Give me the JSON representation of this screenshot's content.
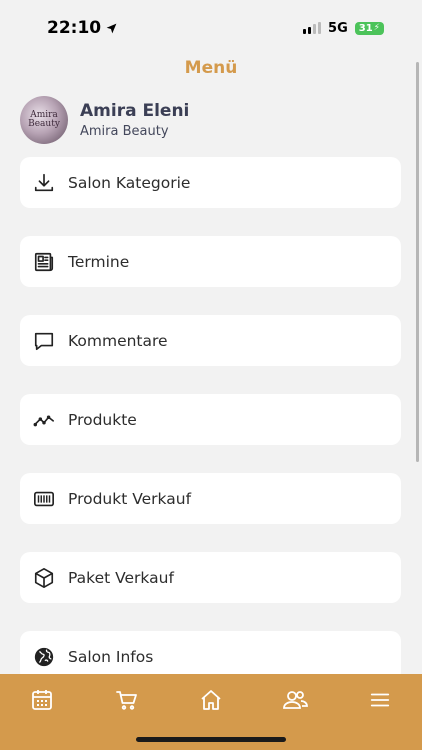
{
  "status": {
    "time": "22:10",
    "network": "5G",
    "battery": "31"
  },
  "header": {
    "title": "Menü"
  },
  "profile": {
    "name": "Amira Eleni",
    "subtitle": "Amira Beauty",
    "avatar_text": "Amira Beauty"
  },
  "menu": {
    "items": [
      {
        "label": "Salon Kategorie",
        "icon": "download-icon"
      },
      {
        "label": "Termine",
        "icon": "newspaper-icon"
      },
      {
        "label": "Kommentare",
        "icon": "chat-icon"
      },
      {
        "label": "Produkte",
        "icon": "trend-icon"
      },
      {
        "label": "Produkt Verkauf",
        "icon": "barcode-icon"
      },
      {
        "label": "Paket Verkauf",
        "icon": "package-icon"
      },
      {
        "label": "Salon Infos",
        "icon": "globe-icon"
      }
    ]
  },
  "tabbar": {
    "items": [
      "calendar-icon",
      "cart-icon",
      "home-icon",
      "users-icon",
      "menu-icon"
    ]
  },
  "colors": {
    "accent": "#d49a4c",
    "background": "#f2f2f2",
    "card": "#ffffff"
  }
}
